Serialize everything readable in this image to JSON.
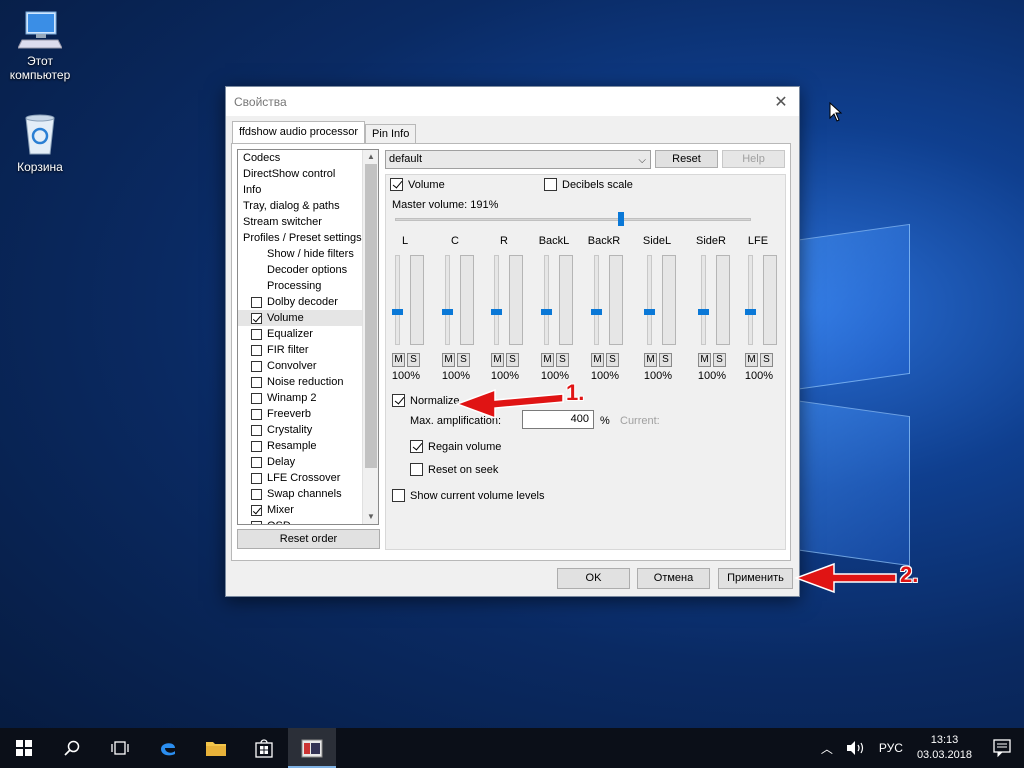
{
  "desktop": {
    "icons": [
      {
        "label": "Этот\nкомпьютер",
        "line1": "Этот",
        "line2": "компьютер"
      },
      {
        "label": "Корзина"
      }
    ]
  },
  "dialog": {
    "title": "Свойства",
    "tabs": [
      {
        "label": "ffdshow audio processor",
        "active": true
      },
      {
        "label": "Pin Info",
        "active": false
      }
    ],
    "left_list": {
      "items": [
        {
          "label": "Codecs",
          "type": "plain"
        },
        {
          "label": "DirectShow control",
          "type": "plain"
        },
        {
          "label": "Info",
          "type": "plain"
        },
        {
          "label": "Tray, dialog & paths",
          "type": "plain"
        },
        {
          "label": "Stream switcher",
          "type": "plain"
        },
        {
          "label": "Profiles / Preset settings",
          "type": "plain"
        },
        {
          "label": "Show / hide filters",
          "type": "indent"
        },
        {
          "label": "Decoder options",
          "type": "indent"
        },
        {
          "label": "Processing",
          "type": "indent"
        },
        {
          "label": "Dolby decoder",
          "type": "check",
          "checked": false
        },
        {
          "label": "Volume",
          "type": "check",
          "checked": true,
          "selected": true
        },
        {
          "label": "Equalizer",
          "type": "check",
          "checked": false
        },
        {
          "label": "FIR filter",
          "type": "check",
          "checked": false
        },
        {
          "label": "Convolver",
          "type": "check",
          "checked": false
        },
        {
          "label": "Noise reduction",
          "type": "check",
          "checked": false
        },
        {
          "label": "Winamp 2",
          "type": "check",
          "checked": false
        },
        {
          "label": "Freeverb",
          "type": "check",
          "checked": false
        },
        {
          "label": "Crystality",
          "type": "check",
          "checked": false
        },
        {
          "label": "Resample",
          "type": "check",
          "checked": false
        },
        {
          "label": "Delay",
          "type": "check",
          "checked": false
        },
        {
          "label": "LFE Crossover",
          "type": "check",
          "checked": false
        },
        {
          "label": "Swap channels",
          "type": "check",
          "checked": false
        },
        {
          "label": "Mixer",
          "type": "check",
          "checked": true
        },
        {
          "label": "OSD",
          "type": "check",
          "checked": false
        }
      ],
      "reset_order_label": "Reset order"
    },
    "preset": {
      "value": "default",
      "reset_label": "Reset",
      "help_label": "Help"
    },
    "volume": {
      "volume_label": "Volume",
      "volume_checked": true,
      "decibels_label": "Decibels scale",
      "decibels_checked": false,
      "master_volume_text": "Master volume: 191%",
      "master_volume_percent": 191,
      "channels": [
        {
          "name": "L",
          "value": "100%"
        },
        {
          "name": "C",
          "value": "100%"
        },
        {
          "name": "R",
          "value": "100%"
        },
        {
          "name": "BackL",
          "value": "100%"
        },
        {
          "name": "BackR",
          "value": "100%"
        },
        {
          "name": "SideL",
          "value": "100%"
        },
        {
          "name": "SideR",
          "value": "100%"
        },
        {
          "name": "LFE",
          "value": "100%"
        }
      ],
      "mute_label": "M",
      "solo_label": "S",
      "normalize_label": "Normalize",
      "normalize_checked": true,
      "max_amp_label": "Max. amplification:",
      "max_amp_value": "400",
      "percent_sign": "%",
      "current_label": "Current:",
      "regain_label": "Regain volume",
      "regain_checked": true,
      "reset_on_seek_label": "Reset on seek",
      "reset_on_seek_checked": false,
      "show_levels_label": "Show current volume levels",
      "show_levels_checked": false
    },
    "buttons": {
      "ok": "OK",
      "cancel": "Отмена",
      "apply": "Применить"
    }
  },
  "annotations": {
    "step1": "1.",
    "step2": "2.",
    "color": "#e01414"
  },
  "taskbar": {
    "lang": "РУС",
    "time": "13:13",
    "date": "03.03.2018"
  }
}
